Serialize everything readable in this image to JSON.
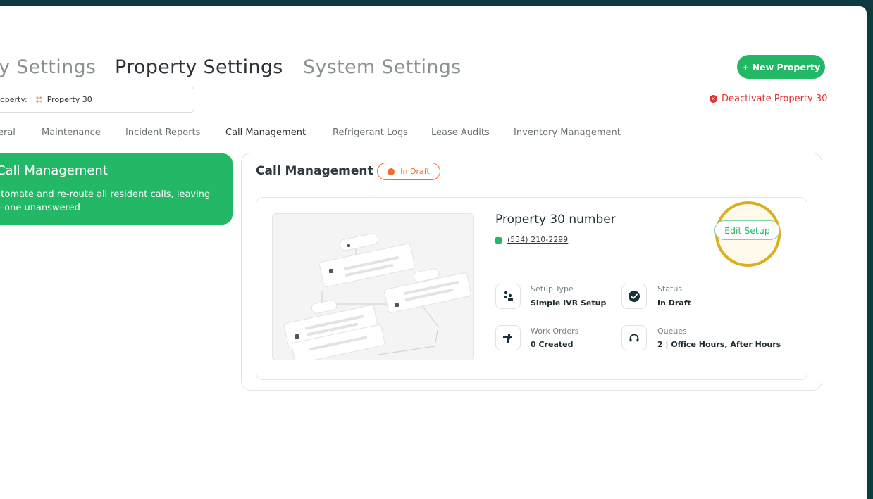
{
  "top_tabs": [
    {
      "label": "y Settings"
    },
    {
      "label": "Property Settings"
    },
    {
      "label": "System Settings"
    }
  ],
  "actions": {
    "new_property": "+ New Property",
    "deactivate": "Deactivate Property 30"
  },
  "property_select": {
    "label": "operty:",
    "value": "Property 30"
  },
  "sub_tabs": [
    {
      "label": "eral"
    },
    {
      "label": "Maintenance"
    },
    {
      "label": "Incident Reports"
    },
    {
      "label": "Call Management"
    },
    {
      "label": "Refrigerant Logs"
    },
    {
      "label": "Lease Audits"
    },
    {
      "label": "Inventory Management"
    }
  ],
  "intro": {
    "title": "Call Management",
    "description": "utomate and re-route all resident calls, leaving o-one unanswered"
  },
  "call_management": {
    "title": "Call Management",
    "status_badge": "In Draft",
    "number_title": "Property 30 number",
    "phone": "(534) 210-2299",
    "edit_button": "Edit Setup",
    "stats": [
      {
        "label": "Setup Type",
        "value": "Simple IVR Setup",
        "icon": "ivr-setup-icon"
      },
      {
        "label": "Status",
        "value": "In Draft",
        "icon": "check-circle-icon"
      },
      {
        "label": "Work Orders",
        "value": "0 Created",
        "icon": "wrench-icon"
      },
      {
        "label": "Queues",
        "value": "2 | Office Hours, After Hours",
        "icon": "headset-icon"
      }
    ]
  },
  "colors": {
    "brand_green": "#22b866",
    "draft_orange": "#f26a2e",
    "danger_red": "#e03131",
    "highlight_ring": "#dcae1d",
    "frame_teal": "#0d3a3f"
  }
}
